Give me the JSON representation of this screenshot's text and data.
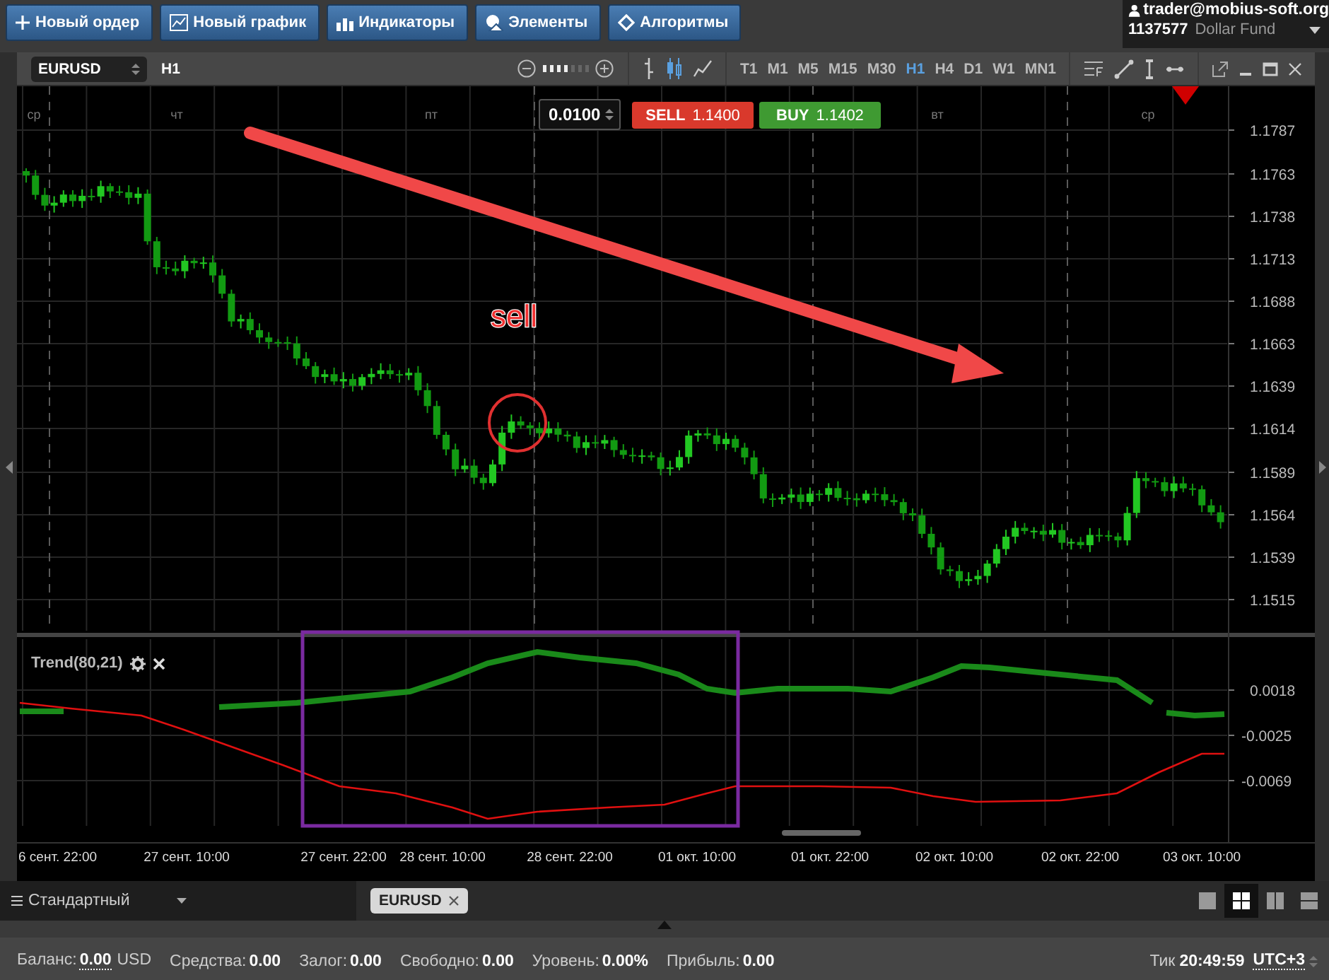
{
  "top_bar": {
    "buttons": [
      {
        "kind": "plus",
        "label": "Новый ордер"
      },
      {
        "kind": "chart",
        "label": "Новый график"
      },
      {
        "kind": "bars",
        "label": "Индикаторы"
      },
      {
        "kind": "elements",
        "label": "Элементы"
      },
      {
        "kind": "diamond",
        "label": "Алгоритмы"
      }
    ]
  },
  "account": {
    "login": "trader@mobius-soft.org",
    "number": "1137577",
    "fund": "Dollar Fund"
  },
  "chart_window": {
    "symbol": "EURUSD",
    "timeframe": "H1",
    "zoom": {
      "level": 0.57
    },
    "periods": [
      {
        "label": "T1",
        "selected": false
      },
      {
        "label": "M1",
        "selected": false
      },
      {
        "label": "M5",
        "selected": false
      },
      {
        "label": "M15",
        "selected": false
      },
      {
        "label": "M30",
        "selected": false
      },
      {
        "label": "H1",
        "selected": true
      },
      {
        "label": "H4",
        "selected": false
      },
      {
        "label": "D1",
        "selected": false
      },
      {
        "label": "W1",
        "selected": false
      },
      {
        "label": "MN1",
        "selected": false
      }
    ],
    "lot": "0.0100",
    "sell": {
      "label": "SELL",
      "price": "1.1400"
    },
    "buy": {
      "label": "BUY",
      "price": "1.1402"
    },
    "day_labels": [
      "ср",
      "чт",
      "пт",
      "вт",
      "ср"
    ],
    "annotation": "sell",
    "price_ticks": [
      "1.1787",
      "1.1763",
      "1.1738",
      "1.1713",
      "1.1688",
      "1.1663",
      "1.1639",
      "1.1614",
      "1.1589",
      "1.1564",
      "1.1539",
      "1.1515"
    ],
    "indicator": {
      "title": "Trend(80,21)",
      "ticks": [
        "0.0018",
        "-0.0025",
        "-0.0069"
      ]
    },
    "time_labels": [
      "6 сент. 22:00",
      "27 сент. 10:00",
      "27 сент. 22:00",
      "28 сент. 10:00",
      "28 сент. 22:00",
      "01 окт. 10:00",
      "01 окт. 22:00",
      "02 окт. 10:00",
      "02 окт. 22:00",
      "03 окт. 10:00"
    ]
  },
  "bottom_bar": {
    "workspace": "Стандартный",
    "tabs": [
      {
        "label": "EURUSD",
        "selected": true
      }
    ],
    "layouts": [
      {
        "kind": "single",
        "selected": false
      },
      {
        "kind": "grid",
        "selected": true
      },
      {
        "kind": "columns",
        "selected": false
      },
      {
        "kind": "rows",
        "selected": false
      }
    ]
  },
  "status_bar": {
    "items": [
      {
        "kind": "selectable",
        "label": "Баланс:",
        "value": "0.00",
        "unit": "USD"
      },
      {
        "kind": "plain",
        "label": "Средства:",
        "value": "0.00"
      },
      {
        "kind": "plain",
        "label": "Залог:",
        "value": "0.00"
      },
      {
        "kind": "plain",
        "label": "Свободно:",
        "value": "0.00"
      },
      {
        "kind": "plain",
        "label": "Уровень:",
        "value": "0.00%"
      },
      {
        "kind": "plain",
        "label": "Прибыль:",
        "value": "0.00"
      }
    ],
    "tick_label": "Тик",
    "time": "20:49:59",
    "timezone": "UTC+3"
  }
}
